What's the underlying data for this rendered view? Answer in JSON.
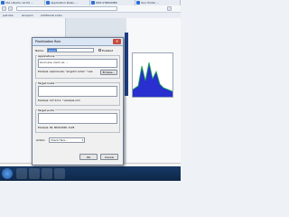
{
  "browser": {
    "tabs": [
      {
        "label": "SSL Ubuntu 12.04 ..."
      },
      {
        "label": "Application Rules ..."
      },
      {
        "label": "DNS STREAMER"
      },
      {
        "label": "Your Portal ..."
      }
    ],
    "url": "",
    "bookmarks": [
      "Just like",
      "Groupon",
      "Additional Links"
    ]
  },
  "dialog": {
    "title": "Prioritization Rule",
    "name_label": "Name:",
    "name_value": "Zoom",
    "enabled_label": "Enabled",
    "applications_label": "Applications",
    "applications_value": "zoom.exe, zoom.us, ...",
    "example_app": "Example: explorer.exe, \"program name\", *.exe",
    "browse_label": "Browse...",
    "target_hosts_label": "Target hosts",
    "example_hosts": "Example: 127.0.0.1, *.example.com",
    "target_ports_label": "Target ports",
    "example_ports": "Example: 80, 8000-9000, 3128",
    "action_label": "Action:",
    "action_value": "Check Here...",
    "ok_label": "OK",
    "cancel_label": "Cancel"
  },
  "status_text": "",
  "colors": {
    "accent": "#3b78d8",
    "taskbar": "#183a66",
    "close": "#c94a3d"
  }
}
